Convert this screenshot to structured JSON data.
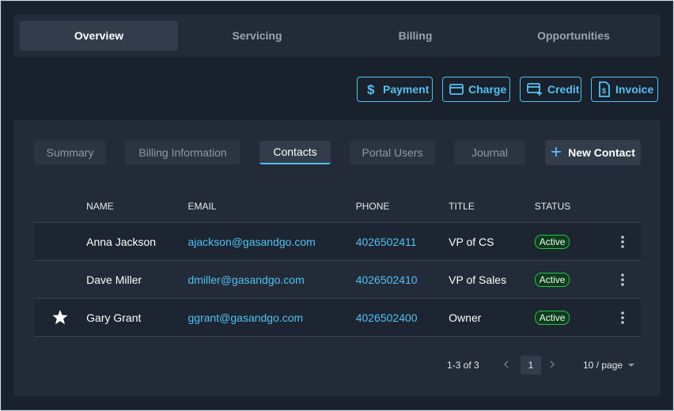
{
  "top_tabs": [
    "Overview",
    "Servicing",
    "Billing",
    "Opportunities"
  ],
  "actions": {
    "payment": "Payment",
    "charge": "Charge",
    "credit": "Credit",
    "invoice": "Invoice"
  },
  "sub_tabs": [
    "Summary",
    "Billing Information",
    "Contacts",
    "Portal Users",
    "Journal"
  ],
  "new_contact": "New Contact",
  "table": {
    "headers": {
      "name": "NAME",
      "email": "EMAIL",
      "phone": "PHONE",
      "title": "TITLE",
      "status": "STATUS"
    },
    "rows": [
      {
        "name": "Anna Jackson",
        "email": "ajackson@gasandgo.com",
        "phone": "4026502411",
        "title": "VP of CS",
        "status": "Active",
        "primary": false
      },
      {
        "name": "Dave Miller",
        "email": "dmiller@gasandgo.com",
        "phone": "4026502410",
        "title": "VP of Sales",
        "status": "Active",
        "primary": false
      },
      {
        "name": "Gary Grant",
        "email": "ggrant@gasandgo.com",
        "phone": "4026502400",
        "title": "Owner",
        "status": "Active",
        "primary": true
      }
    ]
  },
  "pagination": {
    "range": "1-3 of 3",
    "page": "1",
    "per_page": "10 / page"
  },
  "icons": {
    "payment": "dollar-icon",
    "charge": "credit-card-icon",
    "credit": "card-plus-icon",
    "invoice": "invoice-icon",
    "new_contact": "plus-icon",
    "primary": "star-icon",
    "row_menu": "more-vertical-icon"
  },
  "colors": {
    "accent": "#52c2f5",
    "active_badge": "#27c24c",
    "background": "#18212c"
  }
}
